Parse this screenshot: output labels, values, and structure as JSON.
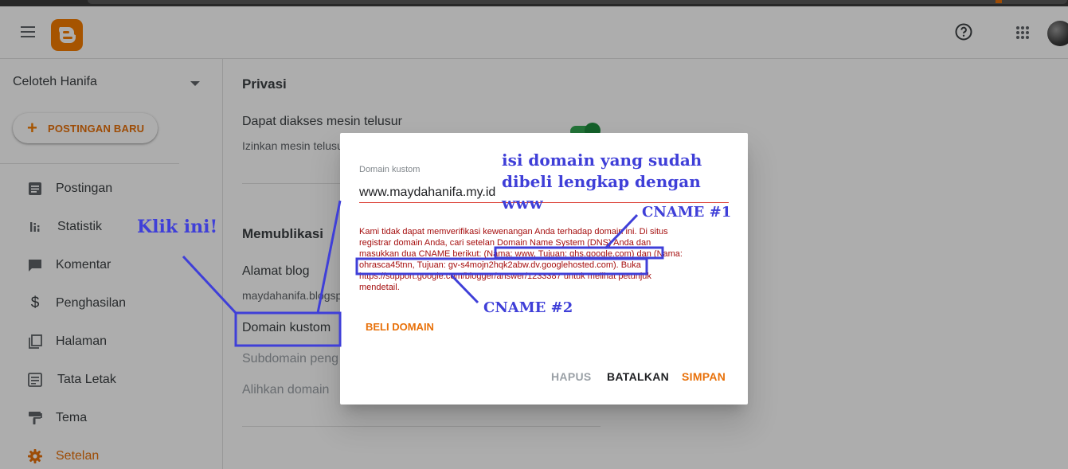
{
  "topbar": {
    "menu_icon": "hamburger-menu-icon",
    "logo_icon": "blogger-logo-icon",
    "help_icon": "help-circle-icon",
    "apps_icon": "apps-grid-icon"
  },
  "sidebar": {
    "blog_name": "Celoteh Hanifa",
    "new_post_label": "POSTINGAN BARU",
    "items": [
      {
        "label": "Postingan",
        "icon": "posts-icon"
      },
      {
        "label": "Statistik",
        "icon": "stats-icon"
      },
      {
        "label": "Komentar",
        "icon": "comment-icon"
      },
      {
        "label": "Penghasilan",
        "icon": "dollar-icon"
      },
      {
        "label": "Halaman",
        "icon": "pages-icon"
      },
      {
        "label": "Tata Letak",
        "icon": "layout-icon"
      },
      {
        "label": "Tema",
        "icon": "paint-roller-icon"
      },
      {
        "label": "Setelan",
        "icon": "gear-icon"
      }
    ]
  },
  "main": {
    "privacy_title": "Privasi",
    "search_title": "Dapat diakses mesin telusur",
    "search_sub": "Izinkan mesin telusur",
    "publish_title": "Memublikasi",
    "address_title": "Alamat blog",
    "address_value": "maydahanifa.blogsp",
    "custom_domain": "Domain kustom",
    "subdomain": "Subdomain peng",
    "redirect": "Alihkan domain"
  },
  "dialog": {
    "field_label": "Domain kustom",
    "field_value": "www.maydahanifa.my.id",
    "error_line1": "Kami tidak dapat memverifikasi kewenangan Anda terhadap domain ini. Di situs",
    "error_line2": "registrar domain Anda, cari setelan Domain Name System (DNS) Anda dan",
    "error_line3a": "masukkan dua CNAME berikut: ",
    "cname1": "(Nama: www, Tujuan: ghs.google.com",
    "error_line3b": ") dan (Nama:",
    "cname2": "ohrasca45tnn, Tujuan: gv-s4mojn2hqk2abw.dv.googlehosted.com",
    "error_line4a": "). Buka",
    "error_line5": "https://support.google.com/blogger/answer/1233387 untuk melihat petunjuk",
    "error_line6": "mendetail.",
    "buy_domain": "BELI DOMAIN",
    "delete": "HAPUS",
    "cancel": "BATALKAN",
    "save": "SIMPAN"
  },
  "annotations": {
    "isi_domain": [
      "isi domain yang sudah",
      "dibeli lengkap dengan",
      "www"
    ],
    "klik_ini": "Klik ini!",
    "cname1": "CNAME #1",
    "cname2": "CNAME #2"
  },
  "colors": {
    "accent": "#e8710a",
    "blogger_orange": "#f57d00",
    "error_red": "#a50e0e",
    "annotation_blue": "#3f3fd8",
    "toggle_green": "#34a853"
  }
}
